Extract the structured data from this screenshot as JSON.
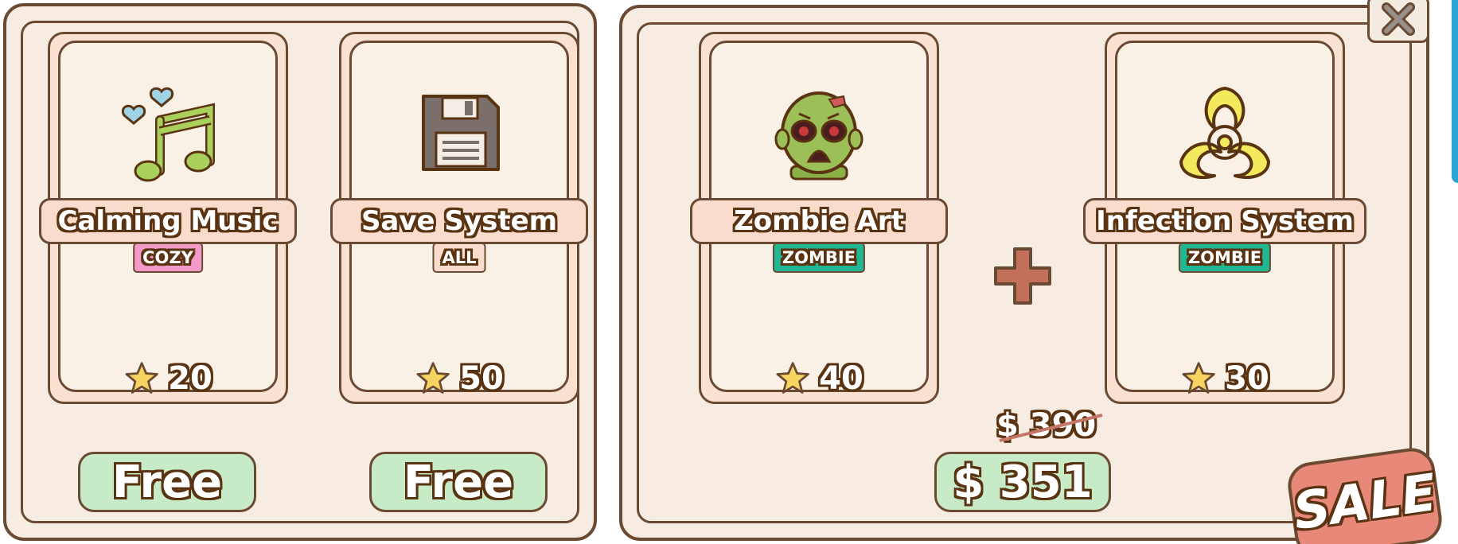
{
  "left_pack": {
    "cards": [
      {
        "name": "Calming Music",
        "tag": "COZY",
        "stars": "20",
        "icon": "music-notes-hearts-icon"
      },
      {
        "name": "Save System",
        "tag": "ALL",
        "stars": "50",
        "icon": "floppy-disk-icon"
      }
    ],
    "buttons": [
      "Free",
      "Free"
    ]
  },
  "right_pack": {
    "cards": [
      {
        "name": "Zombie Art",
        "tag": "ZOMBIE",
        "stars": "40",
        "icon": "zombie-head-icon"
      },
      {
        "name": "Infection System",
        "tag": "ZOMBIE",
        "stars": "30",
        "icon": "biohazard-icon"
      }
    ],
    "old_price": "$ 390",
    "price": "$ 351",
    "sale_label": "SALE",
    "combine_icon": "plus-icon"
  },
  "colors": {
    "outline": "#5a3312",
    "panel": "#f6ece1",
    "banner": "#f9dccb",
    "free_button": "#c7ebc6",
    "tag_cozy": "#f49ac8",
    "tag_zombie": "#1fb892",
    "sale": "#e88878"
  }
}
